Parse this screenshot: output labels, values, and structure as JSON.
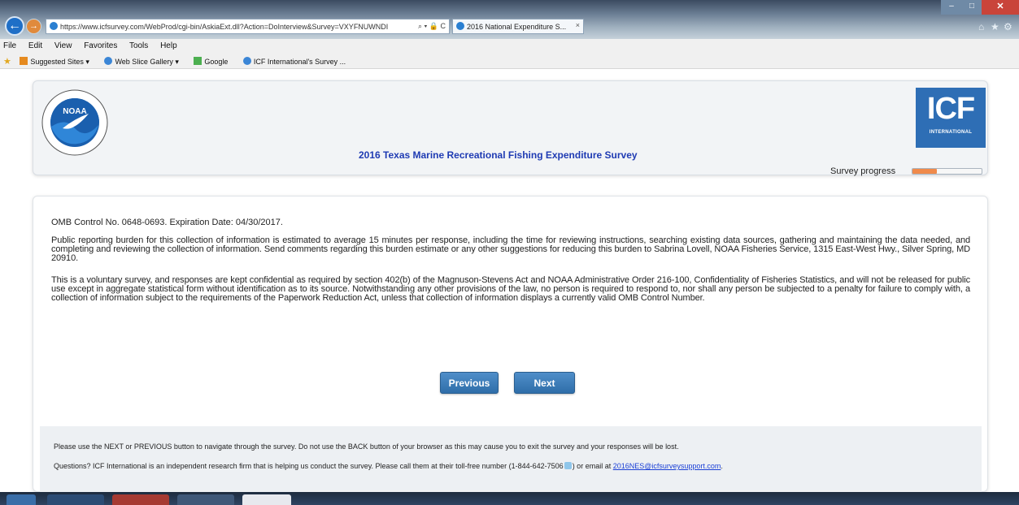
{
  "browser": {
    "url": "https://www.icfsurvey.com/WebProd/cgi-bin/AskiaExt.dll?Action=DoInterview&Survey=VXYFNUWNDI",
    "url_controls": "⌕ ▾ 🔒 C",
    "tab_title": "2016 National Expenditure S...",
    "menu": [
      "File",
      "Edit",
      "View",
      "Favorites",
      "Tools",
      "Help"
    ],
    "favorites": [
      "Suggested Sites ▾",
      "Web Slice Gallery ▾",
      "Google",
      "ICF International's Survey ..."
    ]
  },
  "header": {
    "title": "2016 Texas Marine Recreational Fishing Expenditure Survey",
    "icf_logo_text": "ICF",
    "icf_logo_sub": "INTERNATIONAL",
    "noaa_logo_text": "NOAA",
    "progress_label": "Survey progress",
    "progress_value": 0.35,
    "progress_color": "#f08a4b"
  },
  "content": {
    "omb": "OMB Control No. 0648-0693. Expiration Date: 04/30/2017.",
    "burden_paragraph": "Public reporting burden for this collection of information is estimated to average 15 minutes per response, including the time for reviewing instructions, searching existing data sources, gathering and maintaining the data needed, and completing and reviewing the collection of information. Send comments regarding this burden estimate or any other suggestions for reducing this burden to Sabrina Lovell, NOAA Fisheries Service, 1315 East-West Hwy., Silver Spring, MD 20910.",
    "voluntary_paragraph": "This is a voluntary survey, and responses are kept confidential as required by section 402(b) of the Magnuson-Stevens Act and NOAA Administrative Order 216-100, Confidentiality of Fisheries Statistics, and will not be released for public use except in aggregate statistical form without identification as to its source. Notwithstanding any other provisions of the law, no person is required to respond to, nor shall any person be subjected to a penalty for failure to comply with, a collection of information subject to the requirements of the Paperwork Reduction Act, unless that collection of information displays a currently valid OMB Control Number.",
    "previous_label": "Previous",
    "next_label": "Next"
  },
  "footer": {
    "nav_note": "Please use the NEXT or PREVIOUS button to navigate through the survey. Do not use the BACK button of your browser as this may cause you to exit the survey and your responses will be lost.",
    "questions_prefix": "Questions? ICF International is an independent research firm that is helping us conduct the survey. Please call them at their toll-free number (1-844-642-7506",
    "questions_middle": ") or email at",
    "email": "2016NES@icfsurveysupport.com",
    "questions_suffix": "."
  }
}
